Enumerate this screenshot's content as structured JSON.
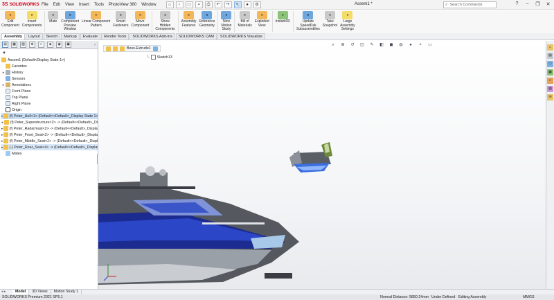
{
  "app": {
    "logo_ds": "3S",
    "logo_text": "SOLIDWORKS",
    "document_title": "Assem1 *",
    "search_placeholder": "Search Commands"
  },
  "menus": [
    "File",
    "Edit",
    "View",
    "Insert",
    "Tools",
    "PhotoView 360",
    "Window"
  ],
  "ribbon": [
    {
      "label": "Edit\nComponent",
      "icon": "edit-component-icon",
      "color": "orange"
    },
    {
      "label": "Insert\nComponents",
      "icon": "insert-components-icon",
      "color": "yellow"
    },
    {
      "label": "Mate",
      "icon": "mate-icon",
      "color": "gray"
    },
    {
      "label": "Component\nPreview\nWindow",
      "icon": "preview-window-icon",
      "color": "blue"
    },
    {
      "label": "Linear Component\nPattern",
      "icon": "linear-pattern-icon",
      "color": "orange"
    },
    {
      "label": "Smart\nFasteners",
      "icon": "smart-fasteners-icon",
      "color": "gray"
    },
    {
      "label": "Move\nComponent",
      "icon": "move-component-icon",
      "color": "orange"
    },
    {
      "label": "Show\nHidden\nComponents",
      "icon": "show-hidden-icon",
      "color": "gray"
    },
    {
      "label": "Assembly\nFeatures",
      "icon": "assembly-features-icon",
      "color": "orange"
    },
    {
      "label": "Reference\nGeometry",
      "icon": "reference-geometry-icon",
      "color": "blue"
    },
    {
      "label": "New\nMotion\nStudy",
      "icon": "motion-study-icon",
      "color": "blue"
    },
    {
      "label": "Bill of\nMaterials",
      "icon": "bom-icon",
      "color": "gray"
    },
    {
      "label": "Exploded\nView",
      "icon": "exploded-view-icon",
      "color": "orange"
    },
    {
      "label": "Instant3D",
      "icon": "instant3d-icon",
      "color": "green"
    },
    {
      "label": "Update\nSpeedPak\nSubassemblies",
      "icon": "speedpak-icon",
      "color": "blue"
    },
    {
      "label": "Take\nSnapshot",
      "icon": "snapshot-icon",
      "color": "gray"
    },
    {
      "label": "Large\nAssembly\nSettings",
      "icon": "large-assembly-icon",
      "color": "yellow"
    }
  ],
  "command_tabs": [
    "Assembly",
    "Layout",
    "Sketch",
    "Markup",
    "Evaluate",
    "Render Tools",
    "SOLIDWORKS Add-Ins",
    "SOLIDWORKS CAM",
    "SOLIDWORKS Visualize"
  ],
  "tree": {
    "root": "Assem1  (Default<Display State-1>)",
    "items": [
      {
        "label": "Favorites",
        "icon": "yellow",
        "exp": ""
      },
      {
        "label": "History",
        "icon": "gray",
        "exp": "▸"
      },
      {
        "label": "Sensors",
        "icon": "sensor",
        "exp": ""
      },
      {
        "label": "Annotations",
        "icon": "anno",
        "exp": "▸"
      },
      {
        "label": "Front Plane",
        "icon": "plane",
        "exp": ""
      },
      {
        "label": "Top Plane",
        "icon": "plane",
        "exp": ""
      },
      {
        "label": "Right Plane",
        "icon": "plane",
        "exp": ""
      },
      {
        "label": "Origin",
        "icon": "origin",
        "exp": ""
      },
      {
        "label": "(f) Peter_Hull<1> (Default<<Default>_Display State 1>",
        "icon": "yellow",
        "exp": "▸",
        "sel": "sel"
      },
      {
        "label": "(f) Peter_Superstructure<2> -> (Default<<Default>_Di",
        "icon": "yellow",
        "exp": "▸"
      },
      {
        "label": "(f) Peter_Radarmast<2> -> (Default<<Default>_Display",
        "icon": "yellow",
        "exp": "▸"
      },
      {
        "label": "(f) Peter_Front_Seat<2> -> (Default<<Default>_Display",
        "icon": "yellow",
        "exp": "▸"
      },
      {
        "label": "(f) Peter_Middle_Seat<2> -> (Default<<Default>_Displ",
        "icon": "yellow",
        "exp": "▸"
      },
      {
        "label": "(-) Peter_Rear_Seat<4> -> (Default<<Default>_Display",
        "icon": "yellow",
        "exp": "▸",
        "sel": "sel2"
      },
      {
        "label": "Mates",
        "icon": "mates",
        "exp": ""
      }
    ]
  },
  "viewport": {
    "breadcrumb": "Boss-Extrude1",
    "sketch_node": "Sketch13"
  },
  "bottom_tabs": [
    "Model",
    "3D Views",
    "Motion Study 1"
  ],
  "status": {
    "left": "SOLIDWORKS Premium 2021 SP5.1",
    "distance": "Normal Distance: 5850.24mm",
    "defined": "Under Defined",
    "mode": "Editing Assembly",
    "units": "MMGS"
  }
}
